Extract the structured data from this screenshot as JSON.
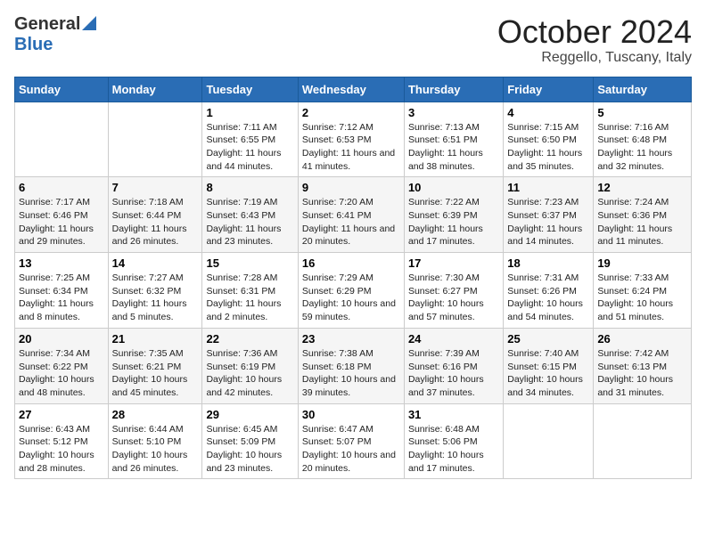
{
  "header": {
    "logo_general": "General",
    "logo_blue": "Blue",
    "month": "October 2024",
    "location": "Reggello, Tuscany, Italy"
  },
  "days_of_week": [
    "Sunday",
    "Monday",
    "Tuesday",
    "Wednesday",
    "Thursday",
    "Friday",
    "Saturday"
  ],
  "weeks": [
    [
      {
        "day": "",
        "info": ""
      },
      {
        "day": "",
        "info": ""
      },
      {
        "day": "1",
        "info": "Sunrise: 7:11 AM\nSunset: 6:55 PM\nDaylight: 11 hours and 44 minutes."
      },
      {
        "day": "2",
        "info": "Sunrise: 7:12 AM\nSunset: 6:53 PM\nDaylight: 11 hours and 41 minutes."
      },
      {
        "day": "3",
        "info": "Sunrise: 7:13 AM\nSunset: 6:51 PM\nDaylight: 11 hours and 38 minutes."
      },
      {
        "day": "4",
        "info": "Sunrise: 7:15 AM\nSunset: 6:50 PM\nDaylight: 11 hours and 35 minutes."
      },
      {
        "day": "5",
        "info": "Sunrise: 7:16 AM\nSunset: 6:48 PM\nDaylight: 11 hours and 32 minutes."
      }
    ],
    [
      {
        "day": "6",
        "info": "Sunrise: 7:17 AM\nSunset: 6:46 PM\nDaylight: 11 hours and 29 minutes."
      },
      {
        "day": "7",
        "info": "Sunrise: 7:18 AM\nSunset: 6:44 PM\nDaylight: 11 hours and 26 minutes."
      },
      {
        "day": "8",
        "info": "Sunrise: 7:19 AM\nSunset: 6:43 PM\nDaylight: 11 hours and 23 minutes."
      },
      {
        "day": "9",
        "info": "Sunrise: 7:20 AM\nSunset: 6:41 PM\nDaylight: 11 hours and 20 minutes."
      },
      {
        "day": "10",
        "info": "Sunrise: 7:22 AM\nSunset: 6:39 PM\nDaylight: 11 hours and 17 minutes."
      },
      {
        "day": "11",
        "info": "Sunrise: 7:23 AM\nSunset: 6:37 PM\nDaylight: 11 hours and 14 minutes."
      },
      {
        "day": "12",
        "info": "Sunrise: 7:24 AM\nSunset: 6:36 PM\nDaylight: 11 hours and 11 minutes."
      }
    ],
    [
      {
        "day": "13",
        "info": "Sunrise: 7:25 AM\nSunset: 6:34 PM\nDaylight: 11 hours and 8 minutes."
      },
      {
        "day": "14",
        "info": "Sunrise: 7:27 AM\nSunset: 6:32 PM\nDaylight: 11 hours and 5 minutes."
      },
      {
        "day": "15",
        "info": "Sunrise: 7:28 AM\nSunset: 6:31 PM\nDaylight: 11 hours and 2 minutes."
      },
      {
        "day": "16",
        "info": "Sunrise: 7:29 AM\nSunset: 6:29 PM\nDaylight: 10 hours and 59 minutes."
      },
      {
        "day": "17",
        "info": "Sunrise: 7:30 AM\nSunset: 6:27 PM\nDaylight: 10 hours and 57 minutes."
      },
      {
        "day": "18",
        "info": "Sunrise: 7:31 AM\nSunset: 6:26 PM\nDaylight: 10 hours and 54 minutes."
      },
      {
        "day": "19",
        "info": "Sunrise: 7:33 AM\nSunset: 6:24 PM\nDaylight: 10 hours and 51 minutes."
      }
    ],
    [
      {
        "day": "20",
        "info": "Sunrise: 7:34 AM\nSunset: 6:22 PM\nDaylight: 10 hours and 48 minutes."
      },
      {
        "day": "21",
        "info": "Sunrise: 7:35 AM\nSunset: 6:21 PM\nDaylight: 10 hours and 45 minutes."
      },
      {
        "day": "22",
        "info": "Sunrise: 7:36 AM\nSunset: 6:19 PM\nDaylight: 10 hours and 42 minutes."
      },
      {
        "day": "23",
        "info": "Sunrise: 7:38 AM\nSunset: 6:18 PM\nDaylight: 10 hours and 39 minutes."
      },
      {
        "day": "24",
        "info": "Sunrise: 7:39 AM\nSunset: 6:16 PM\nDaylight: 10 hours and 37 minutes."
      },
      {
        "day": "25",
        "info": "Sunrise: 7:40 AM\nSunset: 6:15 PM\nDaylight: 10 hours and 34 minutes."
      },
      {
        "day": "26",
        "info": "Sunrise: 7:42 AM\nSunset: 6:13 PM\nDaylight: 10 hours and 31 minutes."
      }
    ],
    [
      {
        "day": "27",
        "info": "Sunrise: 6:43 AM\nSunset: 5:12 PM\nDaylight: 10 hours and 28 minutes."
      },
      {
        "day": "28",
        "info": "Sunrise: 6:44 AM\nSunset: 5:10 PM\nDaylight: 10 hours and 26 minutes."
      },
      {
        "day": "29",
        "info": "Sunrise: 6:45 AM\nSunset: 5:09 PM\nDaylight: 10 hours and 23 minutes."
      },
      {
        "day": "30",
        "info": "Sunrise: 6:47 AM\nSunset: 5:07 PM\nDaylight: 10 hours and 20 minutes."
      },
      {
        "day": "31",
        "info": "Sunrise: 6:48 AM\nSunset: 5:06 PM\nDaylight: 10 hours and 17 minutes."
      },
      {
        "day": "",
        "info": ""
      },
      {
        "day": "",
        "info": ""
      }
    ]
  ]
}
